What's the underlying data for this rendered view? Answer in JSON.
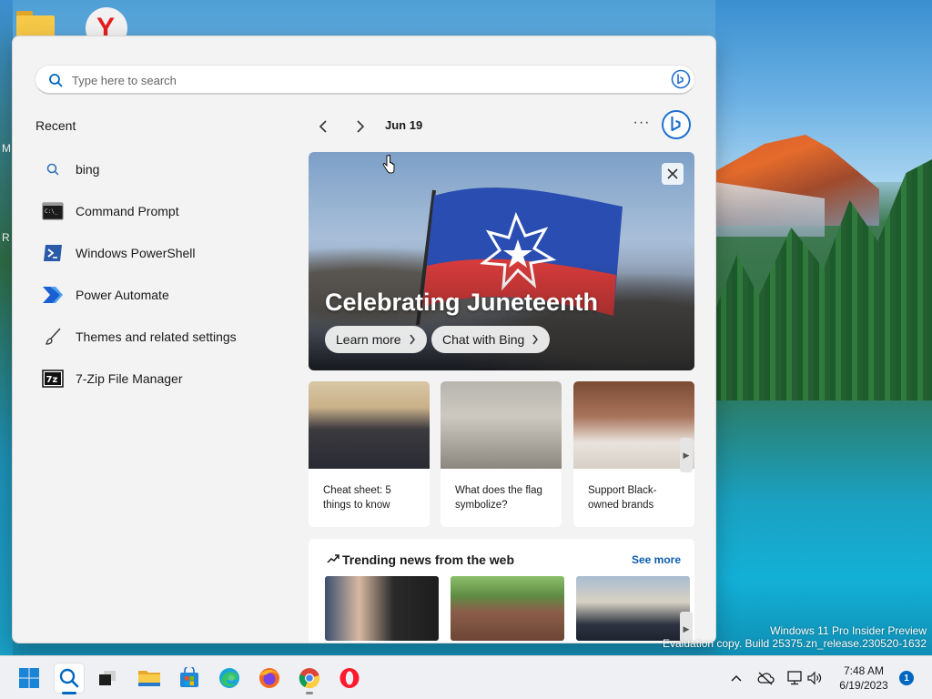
{
  "desktop": {
    "watermark_line1": "Windows 11 Pro Insider Preview",
    "watermark_line2": "Evaluation copy. Build 25375.zn_release.230520-1632",
    "edge_letters": [
      "M",
      "R"
    ]
  },
  "search": {
    "placeholder": "Type here to search"
  },
  "recent": {
    "title": "Recent",
    "items": [
      {
        "label": "bing",
        "icon": "search-icon"
      },
      {
        "label": "Command Prompt",
        "icon": "command-prompt-icon"
      },
      {
        "label": "Windows PowerShell",
        "icon": "powershell-icon"
      },
      {
        "label": "Power Automate",
        "icon": "power-automate-icon"
      },
      {
        "label": "Themes and related settings",
        "icon": "paintbrush-icon"
      },
      {
        "label": "7-Zip File Manager",
        "icon": "7zip-icon"
      }
    ]
  },
  "highlights": {
    "date": "Jun 19",
    "more": "···",
    "hero": {
      "title": "Celebrating Juneteenth",
      "button1": "Learn more",
      "button2": "Chat with Bing"
    },
    "cards": [
      {
        "text": "Cheat sheet: 5 things to know"
      },
      {
        "text": "What does the flag symbolize?"
      },
      {
        "text": "Support Black-owned brands"
      }
    ],
    "trending": {
      "title": "Trending news from the web",
      "see_more": "See more"
    }
  },
  "taskbar": {
    "apps": [
      "start-icon",
      "search-icon",
      "task-view-icon",
      "file-explorer-icon",
      "microsoft-store-icon",
      "edge-icon",
      "firefox-icon",
      "chrome-icon",
      "opera-icon"
    ],
    "time": "7:48 AM",
    "date": "6/19/2023",
    "notifications": "1"
  },
  "colors": {
    "accent": "#0067c0",
    "panel_bg": "#f3f3f3",
    "link": "#0b5cad"
  }
}
